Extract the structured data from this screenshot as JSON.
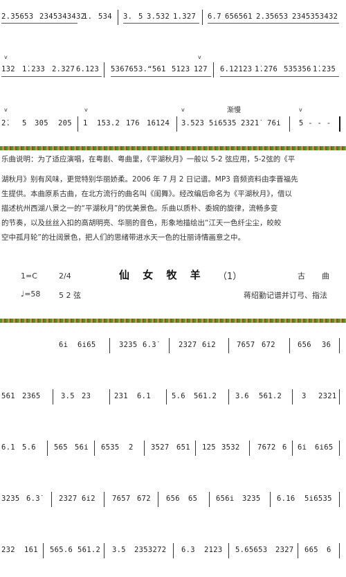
{
  "score_top": {
    "line1": [
      "2.35653",
      "2345343432",
      "1.",
      "534",
      "3.",
      "5",
      "3.532",
      "1.327",
      "6.7",
      "656561",
      "2.35653",
      "2345353432"
    ],
    "line2": [
      "1̇32",
      "1̇.233",
      "2.327",
      "6.123",
      "536765",
      "3.“561",
      "5123",
      "1̇27",
      "6.1̇21̇23",
      "1̇.2̇76",
      "535356",
      "1̇.235"
    ],
    "line3": [
      "2̇.",
      "5",
      "305",
      "205",
      "1",
      "153.2",
      "176",
      "16124",
      "3.523",
      "5i6535",
      "232̇1̇",
      "76i",
      "5 - - -"
    ],
    "tempo_marking": "渐慢"
  },
  "explanation": {
    "lines": [
      "乐曲说明：为了适应演唱，在粤剧、粤曲里，《平湖秋月》一般以 5-2 弦应用，5-2弦的《平",
      "湖秋月》别有风味，更觉特别华丽娇柔。2006 年 7 月 2 日记谱。MP3 音频资料由李晋福先",
      "生提供。本曲原系古曲，在北方流行的曲名叫《闺舞》。经改编后命名为《平湖秋月》，借以",
      "描述杭州西湖八景之一的“平湖秋月”的优美景色。乐曲以质朴、委婉的旋律，流畅多变",
      "的节奏，以及丝丝入扣的高胡明亮、华丽的音色，形象地描绘出“江天一色纤尘尘，皎皎",
      "空中孤月轮”的壮阔景色，把人们的思绪带进水天一色的壮丽诗情画意之中。"
    ]
  },
  "piece_header": {
    "key": "1=C",
    "meter": "2/4",
    "title": "仙 女 牧 羊",
    "number": "（1）",
    "category1": "古",
    "category2": "曲",
    "tempo": "♩=58",
    "strings": "5 2  弦",
    "arranger": "蒋绍勤记谱并订弓、指法"
  },
  "score_bottom": {
    "line1": [
      "6i",
      "6i65",
      "3235",
      "6.3̇",
      "2327",
      "6i2",
      "7657",
      "672",
      "656",
      "36"
    ],
    "line2": [
      "561",
      "2365",
      "3.5",
      "23",
      "231",
      "6.1",
      "5.6",
      "561.2",
      "3.6",
      "561.2",
      "3",
      "2321"
    ],
    "line3": [
      "6.1",
      "5.6",
      "565",
      "56i",
      "6535",
      "2",
      "3527",
      "651",
      "125",
      "3532",
      "7672",
      "6",
      "6i",
      "6i65"
    ],
    "line4": [
      "3235",
      "6.3̇",
      "2327",
      "6i2",
      "7657",
      "672",
      "656",
      "65",
      "656i",
      "3235",
      "6.16",
      "5i6535"
    ],
    "line5": [
      "232",
      "161",
      "565.6",
      "561.2",
      "3.5",
      "2353272",
      "6.3",
      "2123",
      "5.65653",
      "2327",
      "665",
      "6"
    ]
  }
}
